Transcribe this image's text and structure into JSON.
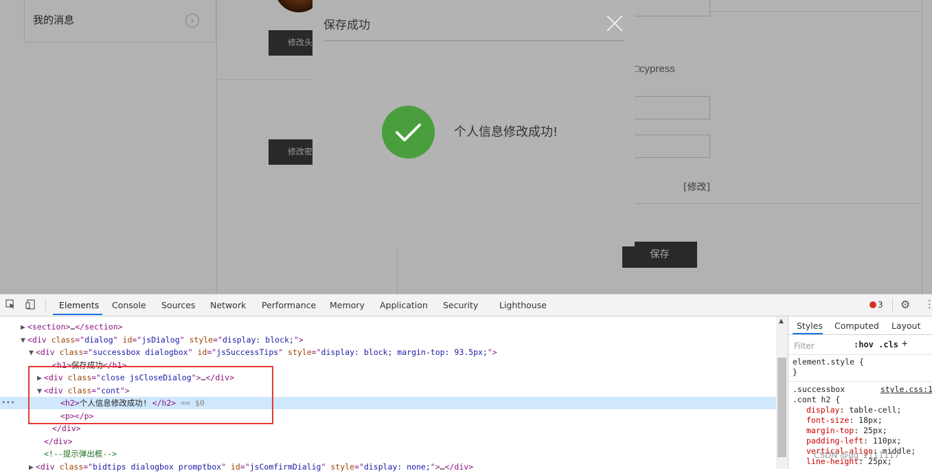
{
  "page": {
    "sidebar_item": "我的消息",
    "modify_button_1": "修改头",
    "modify_button_2": "修改密",
    "checkbox_label": "□cypress",
    "modify_link": "[修改]",
    "save_button": "保存"
  },
  "dialog": {
    "title": "保存成功",
    "message": "个人信息修改成功!",
    "success_color": "#4a9e3e"
  },
  "devtools": {
    "tabs": [
      "Elements",
      "Console",
      "Sources",
      "Network",
      "Performance",
      "Memory",
      "Application",
      "Security",
      "Lighthouse"
    ],
    "active_tab": "Elements",
    "error_count": "3",
    "code_lines": [
      {
        "indent": 30,
        "tri": "▶",
        "html": "<span class='tag'>&lt;section&gt;</span><span class='txt'>…</span><span class='tag'>&lt;/section&gt;</span>"
      },
      {
        "indent": 30,
        "tri": "▼",
        "html": "<span class='tag'>&lt;div </span><span class='attr'>class</span><span class='tag'>=\"</span><span class='val'>dialog</span><span class='tag'>\" </span><span class='attr'>id</span><span class='tag'>=\"</span><span class='val'>jsDialog</span><span class='tag'>\" </span><span class='attr'>style</span><span class='tag'>=\"</span><span class='val'>display: block;</span><span class='tag'>\"&gt;</span>"
      },
      {
        "indent": 42,
        "tri": "▼",
        "html": "<span class='tag'>&lt;div </span><span class='attr'>class</span><span class='tag'>=\"</span><span class='val'>successbox dialogbox</span><span class='tag'>\" </span><span class='attr'>id</span><span class='tag'>=\"</span><span class='val'>jsSuccessTips</span><span class='tag'>\" </span><span class='attr'>style</span><span class='tag'>=\"</span><span class='val'>display: block; margin-top: 93.5px;</span><span class='tag'>\"&gt;</span>"
      },
      {
        "indent": 66,
        "tri": "",
        "html": "<span class='tag'>&lt;h1&gt;</span><span class='txt'>保存成功</span><span class='tag'>&lt;/h1&gt;</span>"
      },
      {
        "indent": 54,
        "tri": "▶",
        "html": "<span class='tag'>&lt;div </span><span class='attr'>class</span><span class='tag'>=\"</span><span class='val'>close jsCloseDialog</span><span class='tag'>\"&gt;</span><span class='txt'>…</span><span class='tag'>&lt;/div&gt;</span>"
      },
      {
        "indent": 54,
        "tri": "▼",
        "html": "<span class='tag'>&lt;div </span><span class='attr'>class</span><span class='tag'>=\"</span><span class='val'>cont</span><span class='tag'>\"&gt;</span>"
      },
      {
        "indent": 78,
        "tri": "",
        "sel": true,
        "html": "<span class='tag'>&lt;h2&gt;</span><span class='txt'>个人信息修改成功!</span> <span class='tag'>&lt;/h2&gt;</span> <span class='dim'>== $0</span>"
      },
      {
        "indent": 78,
        "tri": "",
        "html": "<span class='tag'>&lt;p&gt;&lt;/p&gt;</span>"
      },
      {
        "indent": 66,
        "tri": "",
        "html": "<span class='tag'>&lt;/div&gt;</span>"
      },
      {
        "indent": 54,
        "tri": "",
        "html": "<span class='tag'>&lt;/div&gt;</span>"
      },
      {
        "indent": 54,
        "tri": "",
        "html": "<span class='cmt'>&lt;!--提示弹出框--&gt;</span>"
      },
      {
        "indent": 42,
        "tri": "▶",
        "html": "<span class='tag'>&lt;div </span><span class='attr'>class</span><span class='tag'>=\"</span><span class='val'>bidtips dialogbox promptbox</span><span class='tag'>\" </span><span class='attr'>id</span><span class='tag'>=\"</span><span class='val'>jsComfirmDialig</span><span class='tag'>\" </span><span class='attr'>style</span><span class='tag'>=\"</span><span class='val'>display: none;</span><span class='tag'>\"&gt;</span><span class='txt'>…</span><span class='tag'>&lt;/div&gt;</span>"
      }
    ],
    "styles_tabs": [
      "Styles",
      "Computed",
      "Layout"
    ],
    "filter_placeholder": "Filter",
    "hov_cls": ":hov .cls",
    "element_style": "element.style {",
    "close_brace": "}",
    "selector_1": ".successbox",
    "selector_2": ".cont h2 {",
    "source_link": "style.css:1",
    "properties": [
      {
        "name": "display",
        "value": "table-cell;"
      },
      {
        "name": "font-size",
        "value": "18px;"
      },
      {
        "name": "margin-top",
        "value": "25px;"
      },
      {
        "name": "padding-left",
        "value": "110px;"
      },
      {
        "name": "vertical-align",
        "value": "middle;"
      },
      {
        "name": "line-height",
        "value": "25px;"
      }
    ],
    "watermark": "CSDN @qq_1111117"
  }
}
